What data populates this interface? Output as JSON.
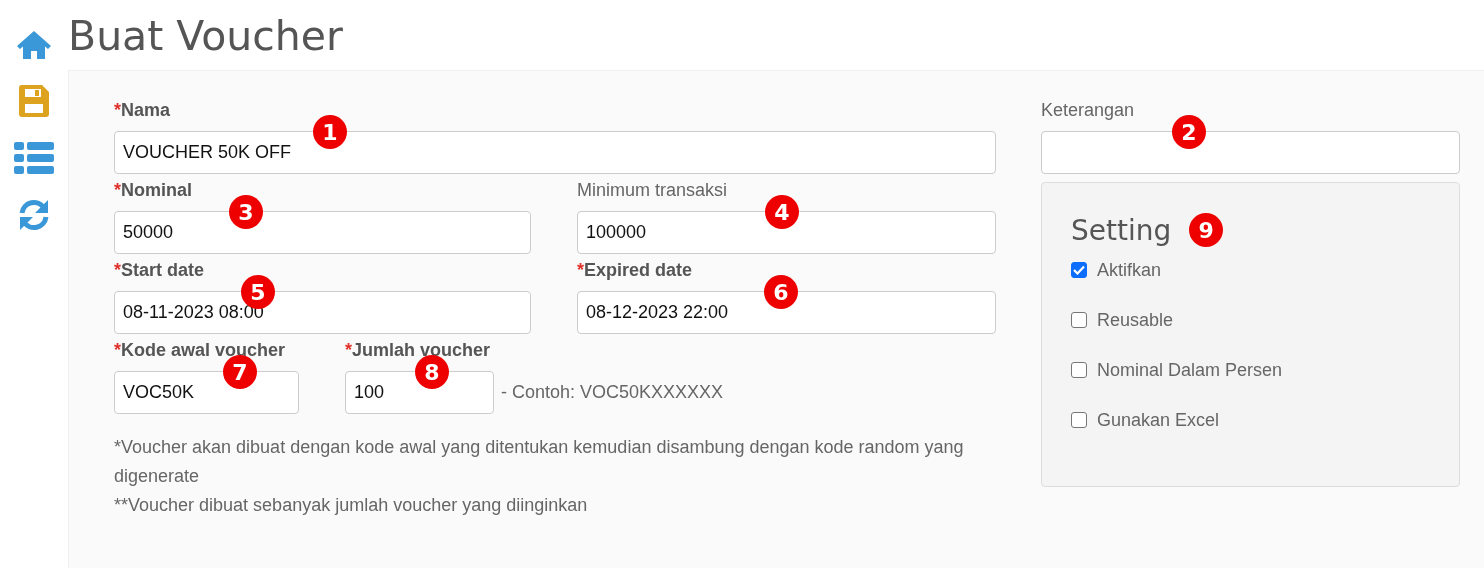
{
  "page": {
    "title": "Buat Voucher"
  },
  "sidebar": {
    "items": [
      {
        "kind": "home"
      },
      {
        "kind": "save"
      },
      {
        "kind": "list"
      },
      {
        "kind": "refresh"
      }
    ]
  },
  "form": {
    "fields": [
      {
        "label": "Nama",
        "required_mark": "*",
        "value": "VOUCHER 50K OFF",
        "marker": "1"
      },
      {
        "label": "Nominal",
        "required_mark": "*",
        "value": "50000",
        "marker": "3"
      },
      {
        "label": "Minimum transaksi",
        "value": "100000",
        "marker": "4"
      },
      {
        "label": "Start date",
        "required_mark": "*",
        "value": "08-11-2023 08:00",
        "marker": "5"
      },
      {
        "label": "Expired date",
        "required_mark": "*",
        "value": "08-12-2023 22:00",
        "marker": "6"
      },
      {
        "label": "Kode awal voucher",
        "required_mark": "*",
        "value": "VOC50K",
        "marker": "7"
      },
      {
        "label": "Jumlah voucher",
        "required_mark": "*",
        "value": "100",
        "marker": "8",
        "hint": "- Contoh: VOC50KXXXXXX"
      }
    ],
    "notes": [
      "*Voucher akan dibuat dengan kode awal yang ditentukan kemudian disambung dengan kode random yang digenerate",
      "**Voucher dibuat sebanyak jumlah voucher yang diinginkan"
    ]
  },
  "keterangan": {
    "label": "Keterangan",
    "marker": "2"
  },
  "setting": {
    "title": "Setting",
    "marker": "9",
    "options": [
      {
        "label": "Aktifkan",
        "checked": true
      },
      {
        "label": "Reusable",
        "checked": false
      },
      {
        "label": "Nominal Dalam Persen",
        "checked": false
      },
      {
        "label": "Gunakan Excel",
        "checked": false
      }
    ]
  }
}
